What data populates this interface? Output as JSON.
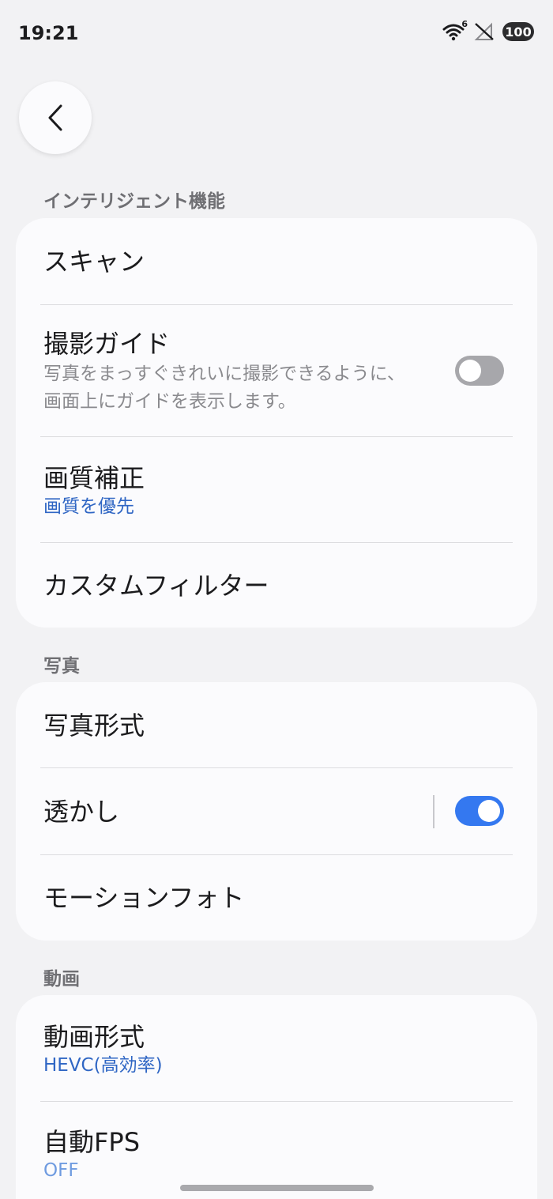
{
  "status_bar": {
    "time": "19:21",
    "wifi_badge": "6",
    "battery": "100",
    "icons": [
      "wifi-icon",
      "no-signal-icon",
      "battery-icon"
    ]
  },
  "nav": {
    "back_icon": "chevron-left-icon"
  },
  "sections": {
    "intelligent": {
      "header": "インテリジェント機能",
      "items": {
        "scan": {
          "title": "スキャン"
        },
        "shooting_guide": {
          "title": "撮影ガイド",
          "description": "写真をまっすぐきれいに撮影できるように、画面上にガイドを表示します。",
          "toggle_on": false
        },
        "image_correction": {
          "title": "画質補正",
          "value": "画質を優先"
        },
        "custom_filter": {
          "title": "カスタムフィルター"
        }
      }
    },
    "photo": {
      "header": "写真",
      "items": {
        "photo_format": {
          "title": "写真形式"
        },
        "watermark": {
          "title": "透かし",
          "toggle_on": true
        },
        "motion_photo": {
          "title": "モーションフォト"
        }
      }
    },
    "video": {
      "header": "動画",
      "items": {
        "video_format": {
          "title": "動画形式",
          "value": "HEVC(高効率)"
        },
        "auto_fps": {
          "title": "自動FPS",
          "value": "OFF"
        }
      }
    }
  },
  "colors": {
    "background": "#f2f2f4",
    "card": "#fbfbfd",
    "accent": "#2f66c4",
    "toggle_on": "#3478f0",
    "toggle_off": "#a7a7ab"
  }
}
